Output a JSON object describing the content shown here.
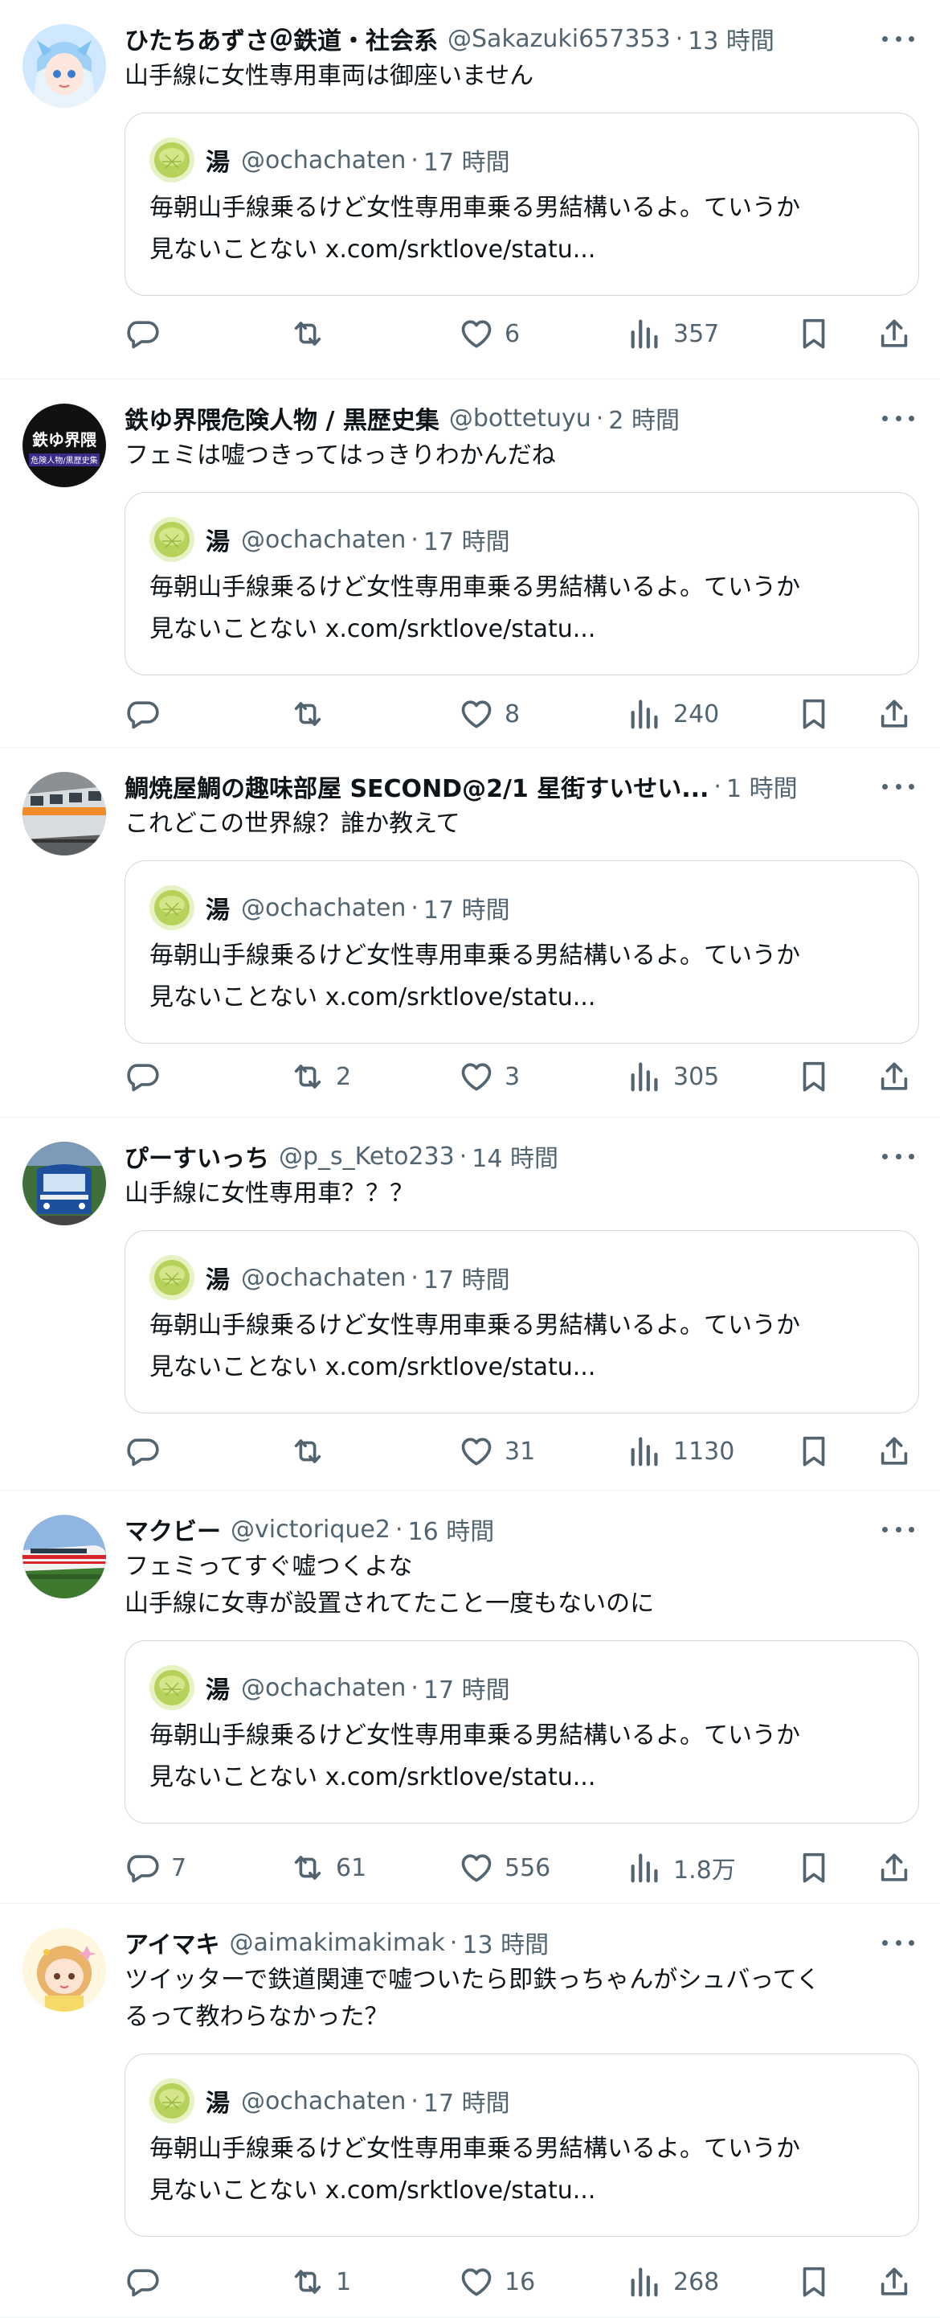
{
  "colors": {
    "text": "#0f1419",
    "secondary": "#536471",
    "border": "#cfd9de",
    "divider": "#eff3f4"
  },
  "quote": {
    "avatar_icon": "melon-bread-avatar",
    "name": "湯",
    "handle": "@ochachaten",
    "separator": "·",
    "time": "17 時間",
    "line1": "毎朝山手線乗るけど女性専用車乗る男結構いるよ。ていうか",
    "line2": "見ないことない x.com/srktlove/statu..."
  },
  "tweets": [
    {
      "avatar_icon": "anime-girl-avatar",
      "name": "ひたちあずさ＠鉄道・社会系",
      "handle": "@Sakazuki657353",
      "separator": "·",
      "time": "13 時間",
      "text": "山手線に女性専用車両は御座いません",
      "replies": "",
      "retweets": "",
      "likes": "6",
      "views": "357"
    },
    {
      "avatar_icon": "railway-logo-avatar",
      "avatar_text": "鉄ゆ界隈",
      "avatar_subtext": "危険人物/黒歴史集",
      "name": "鉄ゆ界隈危険人物 / 黒歴史集",
      "handle": "@bottetuyu",
      "separator": "·",
      "time": "2 時間",
      "text": "フェミは嘘つきってはっきりわかんだね",
      "replies": "",
      "retweets": "",
      "likes": "8",
      "views": "240"
    },
    {
      "avatar_icon": "train-photo-avatar",
      "name": "鯛焼屋鯛の趣味部屋 SECOND@2/1 星街すいせい...",
      "handle": "",
      "separator": "·",
      "time": "1 時間",
      "text": "これどこの世界線？誰か教えて",
      "replies": "",
      "retweets": "2",
      "likes": "3",
      "views": "305"
    },
    {
      "avatar_icon": "blue-train-avatar",
      "name": "ぴーすいっち",
      "handle": "@p_s_Keto233",
      "separator": "·",
      "time": "14 時間",
      "text": "山手線に女性専用車？？？",
      "replies": "",
      "retweets": "",
      "likes": "31",
      "views": "1130"
    },
    {
      "avatar_icon": "express-train-avatar",
      "name": "マクビー",
      "handle": "@victorique2",
      "separator": "·",
      "time": "16 時間",
      "text": "フェミってすぐ嘘つくよな\n山手線に女専が設置されてたこと一度もないのに",
      "replies": "7",
      "retweets": "61",
      "likes": "556",
      "views": "1.8万"
    },
    {
      "avatar_icon": "chibi-girl-avatar",
      "name": "アイマキ",
      "handle": "@aimakimakimak",
      "separator": "·",
      "time": "13 時間",
      "text": "ツイッターで鉄道関連で嘘ついたら即鉄っちゃんがシュバってく\nるって教わらなかった？",
      "replies": "",
      "retweets": "1",
      "likes": "16",
      "views": "268"
    }
  ]
}
